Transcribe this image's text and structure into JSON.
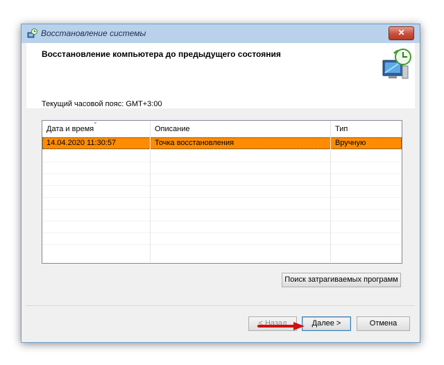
{
  "window": {
    "title": "Восстановление системы",
    "close_label": "✕"
  },
  "header": {
    "title": "Восстановление компьютера до предыдущего состояния"
  },
  "timezone": {
    "label": "Текущий часовой пояс: GMT+3:00"
  },
  "table": {
    "columns": [
      "Дата и время",
      "Описание",
      "Тип"
    ],
    "sort_indicator": "⌄",
    "rows": [
      {
        "date": "14.04.2020 11:30:57",
        "description": "Точка восстановления",
        "type": "Вручную",
        "selected": true
      }
    ]
  },
  "buttons": {
    "search": "Поиск затрагиваемых программ",
    "back": "< Назад",
    "next": "Далее >",
    "cancel": "Отмена"
  },
  "colors": {
    "selection": "#ff8c00",
    "arrow": "#d01010"
  },
  "icons": [
    "system-restore-icon",
    "computer-restore-icon",
    "close-icon",
    "sort-indicator-icon"
  ]
}
